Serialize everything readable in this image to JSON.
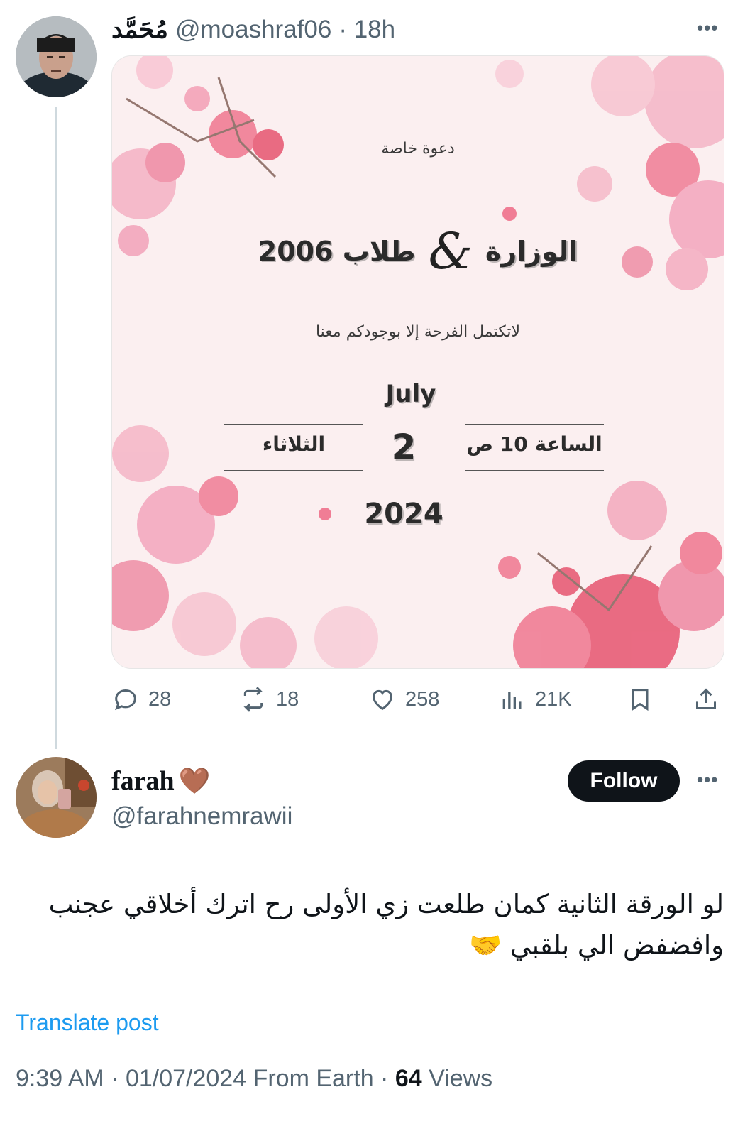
{
  "tweet": {
    "author": {
      "display_name": "مُحَمَّد",
      "handle": "@moashraf06",
      "time": "· 18h"
    },
    "more_label": "•••",
    "image": {
      "small_title": "دعوة خاصة",
      "title_left": "الوزارة",
      "title_amp": "&",
      "title_right": "طلاب 2006",
      "subtitle": "لاتكتمل الفرحة إلا بوجودكم معنا",
      "month": "July",
      "day": "2",
      "weekday": "الثلاثاء",
      "time": "الساعة 10 ص",
      "year": "2024"
    },
    "actions": {
      "replies": "28",
      "reposts": "18",
      "likes": "258",
      "views": "21K"
    }
  },
  "reply": {
    "display_name": "farah",
    "emoji": "🤎",
    "handle": "@farahnemrawii",
    "follow_label": "Follow",
    "more_label": "•••",
    "text_line1": "لو الورقة الثانية كمان طلعت زي الأولى رح اترك أخلاقي عجنب",
    "text_line2": "وافضفض الي بلقبي 🤝",
    "translate_label": "Translate post",
    "meta_prefix": "9:39 AM · 01/07/2024 From Earth · ",
    "views_count": "64",
    "views_label": " Views"
  },
  "colors": {
    "text_primary": "#0f1419",
    "text_secondary": "#536471",
    "link": "#1d9bf0",
    "follow_bg": "#0f1419",
    "card_bg": "#fbeff0",
    "flower_pink": "#f3a6bd",
    "flower_deep": "#e8657f"
  },
  "icons": [
    "reply-icon",
    "repost-icon",
    "like-icon",
    "views-icon",
    "bookmark-icon",
    "share-icon",
    "more-icon"
  ]
}
